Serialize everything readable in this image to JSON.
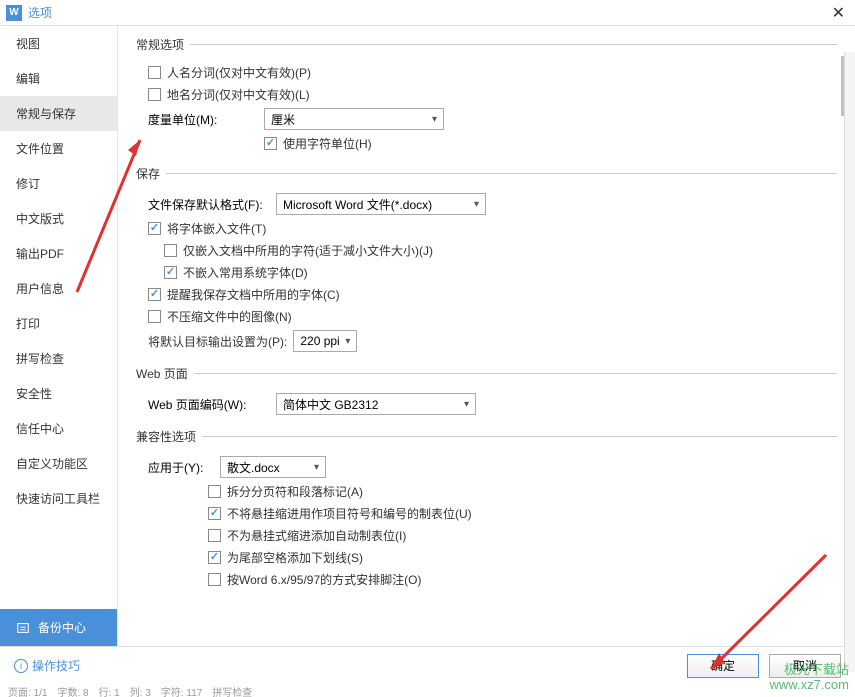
{
  "titlebar": {
    "title": "选项",
    "app_icon": "W"
  },
  "sidebar": {
    "items": [
      {
        "label": "视图"
      },
      {
        "label": "编辑"
      },
      {
        "label": "常规与保存",
        "active": true
      },
      {
        "label": "文件位置"
      },
      {
        "label": "修订"
      },
      {
        "label": "中文版式"
      },
      {
        "label": "输出PDF"
      },
      {
        "label": "用户信息"
      },
      {
        "label": "打印"
      },
      {
        "label": "拼写检查"
      },
      {
        "label": "安全性"
      },
      {
        "label": "信任中心"
      },
      {
        "label": "自定义功能区"
      },
      {
        "label": "快速访问工具栏"
      }
    ],
    "backup": "备份中心"
  },
  "sections": {
    "general": {
      "legend": "常规选项",
      "name_seg": {
        "label": "人名分词(仅对中文有效)(P)",
        "checked": false
      },
      "place_seg": {
        "label": "地名分词(仅对中文有效)(L)",
        "checked": false
      },
      "unit": {
        "label": "度量单位(M):",
        "value": "厘米"
      },
      "char_unit": {
        "label": "使用字符单位(H)",
        "checked": true
      }
    },
    "save": {
      "legend": "保存",
      "default_fmt": {
        "label": "文件保存默认格式(F):",
        "value": "Microsoft Word 文件(*.docx)"
      },
      "embed_font": {
        "label": "将字体嵌入文件(T)",
        "checked": true
      },
      "embed_used": {
        "label": "仅嵌入文档中所用的字符(适于减小文件大小)(J)",
        "checked": false
      },
      "no_common": {
        "label": "不嵌入常用系统字体(D)",
        "checked": true
      },
      "remind": {
        "label": "提醒我保存文档中所用的字体(C)",
        "checked": true
      },
      "no_compress": {
        "label": "不压缩文件中的图像(N)",
        "checked": false
      },
      "ppi": {
        "label": "将默认目标输出设置为(P):",
        "value": "220 ppi"
      }
    },
    "web": {
      "legend": "Web 页面",
      "encoding": {
        "label": "Web 页面编码(W):",
        "value": "简体中文 GB2312"
      }
    },
    "compat": {
      "legend": "兼容性选项",
      "apply": {
        "label": "应用于(Y):",
        "value": "散文.docx"
      },
      "split": {
        "label": "拆分分页符和段落标记(A)",
        "checked": false
      },
      "no_hanging": {
        "label": "不将悬挂缩进用作项目符号和编号的制表位(U)",
        "checked": true
      },
      "no_auto_tab": {
        "label": "不为悬挂式缩进添加自动制表位(I)",
        "checked": false
      },
      "underline_space": {
        "label": "为尾部空格添加下划线(S)",
        "checked": true
      },
      "word6": {
        "label": "按Word 6.x/95/97的方式安排脚注(O)",
        "checked": false
      }
    }
  },
  "footer": {
    "tips": "操作技巧",
    "ok": "确定",
    "cancel": "取消"
  },
  "watermark": {
    "l1": "极光下载站",
    "l2": "www.xz7.com"
  },
  "statusbar": "页面: 1/1　字数: 8　行: 1　列: 3　字符: 117　拼写检查"
}
